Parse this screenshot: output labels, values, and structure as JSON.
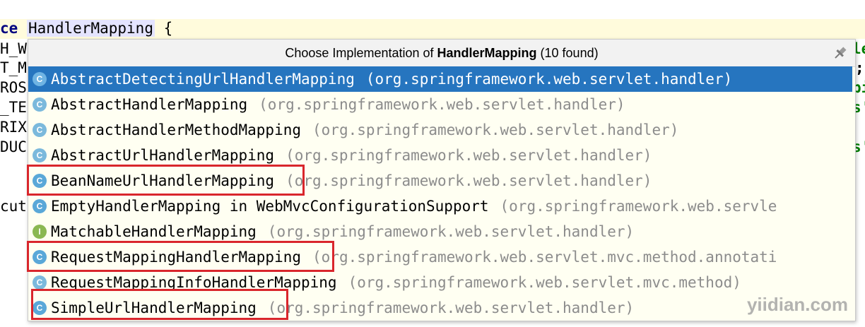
{
  "editor": {
    "line0": {
      "keyword": "ce",
      "identifier": "HandlerMapping",
      "suffix": " {"
    },
    "left_fragments": [
      "H_W",
      "T_M",
      "ROS",
      "_TE",
      "RIX",
      "DUC",
      "",
      "cut"
    ],
    "right_fragments": [
      "le",
      ";",
      "pi",
      "s'",
      "s'"
    ]
  },
  "popup": {
    "title_prefix": "Choose Implementation of ",
    "title_class": "HandlerMapping",
    "title_suffix": " (10 found)",
    "pin_icon": "pin-icon",
    "items": [
      {
        "icon": "class-icon",
        "icon_letter": "C",
        "name": "AbstractDetectingUrlHandlerMapping",
        "package": "(org.springframework.web.servlet.handler)",
        "selected": true
      },
      {
        "icon": "abstract-class-icon",
        "icon_letter": "C",
        "name": "AbstractHandlerMapping",
        "package": "(org.springframework.web.servlet.handler)"
      },
      {
        "icon": "abstract-class-icon",
        "icon_letter": "C",
        "name": "AbstractHandlerMethodMapping",
        "package": "(org.springframework.web.servlet.handler)"
      },
      {
        "icon": "abstract-class-icon",
        "icon_letter": "C",
        "name": "AbstractUrlHandlerMapping",
        "package": "(org.springframework.web.servlet.handler)"
      },
      {
        "icon": "class-icon",
        "icon_letter": "C",
        "name": "BeanNameUrlHandlerMapping",
        "package": "(org.springframework.web.servlet.handler)",
        "highlighted": true
      },
      {
        "icon": "class-icon",
        "icon_letter": "C",
        "name": "EmptyHandlerMapping in WebMvcConfigurationSupport",
        "package": "(org.springframework.web.servle"
      },
      {
        "icon": "interface-icon",
        "icon_letter": "I",
        "name": "MatchableHandlerMapping",
        "package": "(org.springframework.web.servlet.handler)"
      },
      {
        "icon": "class-icon",
        "icon_letter": "C",
        "name": "RequestMappingHandlerMapping",
        "package": "(org.springframework.web.servlet.mvc.method.annotati",
        "highlighted": true
      },
      {
        "icon": "abstract-class-icon",
        "icon_letter": "C",
        "name": "RequestMappingInfoHandlerMapping",
        "package": "(org.springframework.web.servlet.mvc.method)"
      },
      {
        "icon": "class-icon",
        "icon_letter": "C",
        "name": "SimpleUrlHandlerMapping",
        "package": "(org.springframework.web.servlet.handler)",
        "highlighted": true
      }
    ]
  },
  "watermark": "yiidian.com",
  "colors": {
    "selection": "#2675bf",
    "highlight_box": "#d9262c",
    "popup_bg": "#fffff2",
    "package_text": "#8c8c8c"
  }
}
